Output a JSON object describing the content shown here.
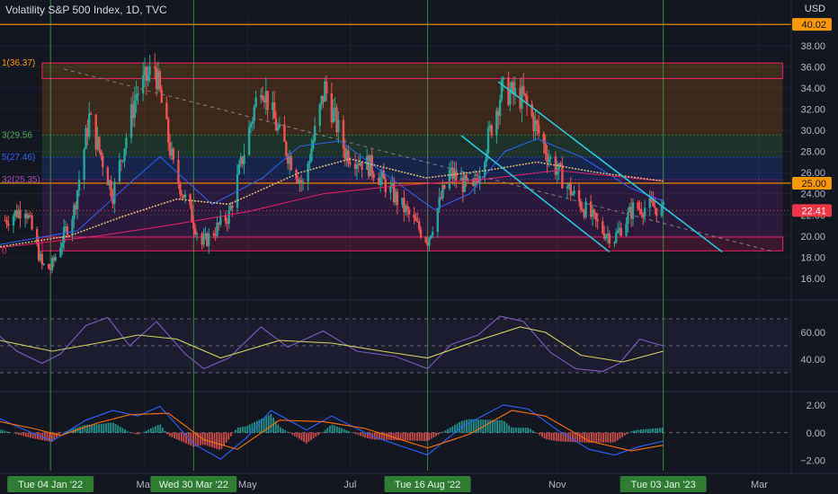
{
  "header": {
    "title": "Volatility S&P 500 Index, 1D, TVC",
    "currency": "USD"
  },
  "colors": {
    "background": "#131722",
    "up": "#26a69a",
    "down": "#ef5350",
    "ma_blue": "#2962ff",
    "ma_red": "#e91e63",
    "ma_dotted": "#d8b272",
    "channel": "#26c6da",
    "level_orange": "#ff9800",
    "rsi": "#7e57c2",
    "macd": "#2962ff",
    "signal": "#ff6d00",
    "vline": "#4caf50"
  },
  "chart_data": [
    {
      "type": "candlestick",
      "title": "Volatility S&P 500 Index, 1D, TVC",
      "y_axis": {
        "ticks": [
          "38.00",
          "36.00",
          "34.00",
          "32.00",
          "30.00",
          "28.00",
          "26.00",
          "24.00",
          "22.00",
          "20.00",
          "18.00",
          "16.00"
        ],
        "range": [
          14.8,
          40.8
        ]
      },
      "x_axis": {
        "date_range": [
          "2021-12-05",
          "2023-03-20"
        ],
        "labels": [
          {
            "date": "2022-03-01",
            "text": "Mar"
          },
          {
            "date": "2022-05-01",
            "text": "May"
          },
          {
            "date": "2022-07-01",
            "text": "Jul"
          },
          {
            "date": "2022-11-01",
            "text": "Nov"
          },
          {
            "date": "2023-03-01",
            "text": "Mar"
          }
        ],
        "highlighted_dates": [
          {
            "date": "2022-01-04",
            "text": "Tue 04 Jan '22"
          },
          {
            "date": "2022-03-30",
            "text": "Wed 30 Mar '22"
          },
          {
            "date": "2022-08-16",
            "text": "Tue 16 Aug '22"
          },
          {
            "date": "2023-01-03",
            "text": "Tue 03 Jan '23"
          }
        ]
      },
      "price_labels": [
        {
          "value": 40.02,
          "text": "40.02",
          "color": "#ff9800"
        },
        {
          "value": 25.0,
          "text": "25.00",
          "color": "#ff9800"
        },
        {
          "value": 22.41,
          "text": "22.41",
          "color": "#f23645"
        }
      ],
      "horizontal_levels": [
        40.02,
        25.0
      ],
      "fib_zones": [
        {
          "top": 36.37,
          "bottom": 34.9,
          "color": "#ff9800"
        },
        {
          "top": 34.9,
          "bottom": 29.56,
          "color": "#f57c00"
        },
        {
          "top": 29.56,
          "bottom": 27.46,
          "color": "#4caf50"
        },
        {
          "top": 27.46,
          "bottom": 25.35,
          "color": "#2962ff"
        },
        {
          "top": 25.35,
          "bottom": 19.9,
          "color": "#9c27b0"
        },
        {
          "top": 19.9,
          "bottom": 18.6,
          "color": "#e91e63"
        }
      ],
      "fib_labels": [
        {
          "value": 36.37,
          "text": "1(36.37)",
          "color": "#ff9800"
        },
        {
          "value": 29.56,
          "text": "3(29.56",
          "color": "#4caf50"
        },
        {
          "value": 27.46,
          "text": "5(27.46)",
          "color": "#2962ff"
        },
        {
          "value": 25.35,
          "text": "32(25.35)",
          "color": "#ab47bc"
        },
        {
          "value": 18.6,
          "text": "0",
          "color": "#e91e63"
        }
      ],
      "key_points": [
        {
          "date": "2021-12-08",
          "value": 21.5
        },
        {
          "date": "2021-12-20",
          "value": 22.8
        },
        {
          "date": "2021-12-30",
          "value": 17.2
        },
        {
          "date": "2022-01-04",
          "value": 16.9
        },
        {
          "date": "2022-01-18",
          "value": 22.5
        },
        {
          "date": "2022-01-27",
          "value": 31.2
        },
        {
          "date": "2022-02-10",
          "value": 24.0
        },
        {
          "date": "2022-02-24",
          "value": 33.5
        },
        {
          "date": "2022-03-07",
          "value": 36.0
        },
        {
          "date": "2022-03-18",
          "value": 26.5
        },
        {
          "date": "2022-04-04",
          "value": 19.2
        },
        {
          "date": "2022-04-20",
          "value": 22.0
        },
        {
          "date": "2022-05-09",
          "value": 34.7
        },
        {
          "date": "2022-05-20",
          "value": 29.5
        },
        {
          "date": "2022-06-03",
          "value": 24.8
        },
        {
          "date": "2022-06-16",
          "value": 34.0
        },
        {
          "date": "2022-06-28",
          "value": 28.0
        },
        {
          "date": "2022-07-14",
          "value": 26.5
        },
        {
          "date": "2022-08-01",
          "value": 22.8
        },
        {
          "date": "2022-08-16",
          "value": 19.6
        },
        {
          "date": "2022-08-29",
          "value": 26.0
        },
        {
          "date": "2022-09-12",
          "value": 24.2
        },
        {
          "date": "2022-09-29",
          "value": 33.8
        },
        {
          "date": "2022-10-12",
          "value": 33.0
        },
        {
          "date": "2022-10-27",
          "value": 27.5
        },
        {
          "date": "2022-11-10",
          "value": 24.0
        },
        {
          "date": "2022-11-28",
          "value": 20.5
        },
        {
          "date": "2022-12-05",
          "value": 19.8
        },
        {
          "date": "2022-12-16",
          "value": 22.6
        },
        {
          "date": "2022-12-28",
          "value": 22.8
        },
        {
          "date": "2023-01-03",
          "value": 22.4
        }
      ],
      "moving_averages": [
        {
          "color": "#2962ff",
          "points": [
            {
              "date": "2021-12-05",
              "value": 19.2
            },
            {
              "date": "2022-01-20",
              "value": 20.5
            },
            {
              "date": "2022-02-20",
              "value": 25.0
            },
            {
              "date": "2022-03-10",
              "value": 27.5
            },
            {
              "date": "2022-04-10",
              "value": 23.0
            },
            {
              "date": "2022-05-10",
              "value": 25.5
            },
            {
              "date": "2022-06-01",
              "value": 28.5
            },
            {
              "date": "2022-06-25",
              "value": 29.0
            },
            {
              "date": "2022-07-25",
              "value": 25.5
            },
            {
              "date": "2022-08-20",
              "value": 22.5
            },
            {
              "date": "2022-09-10",
              "value": 24.0
            },
            {
              "date": "2022-10-01",
              "value": 28.0
            },
            {
              "date": "2022-10-20",
              "value": 29.2
            },
            {
              "date": "2022-11-15",
              "value": 27.5
            },
            {
              "date": "2022-12-15",
              "value": 24.5
            },
            {
              "date": "2023-01-03",
              "value": 23.3
            }
          ]
        },
        {
          "color": "#e91e63",
          "points": [
            {
              "date": "2021-12-05",
              "value": 18.9
            },
            {
              "date": "2022-02-01",
              "value": 20.0
            },
            {
              "date": "2022-03-15",
              "value": 21.0
            },
            {
              "date": "2022-05-01",
              "value": 22.3
            },
            {
              "date": "2022-06-15",
              "value": 24.0
            },
            {
              "date": "2022-08-01",
              "value": 24.8
            },
            {
              "date": "2022-09-15",
              "value": 25.3
            },
            {
              "date": "2022-11-01",
              "value": 26.2
            },
            {
              "date": "2023-01-03",
              "value": 25.2
            }
          ]
        },
        {
          "color": "#d8b272",
          "dashed": true,
          "points": [
            {
              "date": "2021-12-05",
              "value": 19.0
            },
            {
              "date": "2022-01-15",
              "value": 20.0
            },
            {
              "date": "2022-02-15",
              "value": 21.8
            },
            {
              "date": "2022-03-20",
              "value": 23.5
            },
            {
              "date": "2022-04-20",
              "value": 23.0
            },
            {
              "date": "2022-06-01",
              "value": 26.0
            },
            {
              "date": "2022-07-01",
              "value": 27.3
            },
            {
              "date": "2022-08-15",
              "value": 25.5
            },
            {
              "date": "2022-09-20",
              "value": 26.2
            },
            {
              "date": "2022-10-20",
              "value": 27.0
            },
            {
              "date": "2022-11-25",
              "value": 26.0
            },
            {
              "date": "2023-01-03",
              "value": 25.2
            }
          ]
        }
      ],
      "trend_lines": [
        {
          "color": "#26c6da",
          "from": {
            "date": "2022-09-27",
            "value": 34.6
          },
          "to": {
            "date": "2023-02-07",
            "value": 18.5
          }
        },
        {
          "color": "#26c6da",
          "from": {
            "date": "2022-09-05",
            "value": 29.5
          },
          "to": {
            "date": "2022-12-02",
            "value": 18.5
          }
        },
        {
          "color": "#7a7f8c",
          "dashed": true,
          "from": {
            "date": "2022-01-12",
            "value": 35.8
          },
          "to": {
            "date": "2023-03-10",
            "value": 18.5
          }
        }
      ]
    },
    {
      "type": "line",
      "name": "RSI",
      "y_axis": {
        "ticks": [
          "60.00",
          "40.00"
        ],
        "range": [
          20,
          80
        ]
      },
      "bands": [
        70,
        50,
        30
      ],
      "series": [
        {
          "color": "#7e57c2",
          "points": [
            {
              "date": "2021-12-05",
              "value": 57
            },
            {
              "date": "2021-12-15",
              "value": 46
            },
            {
              "date": "2021-12-30",
              "value": 37
            },
            {
              "date": "2022-01-10",
              "value": 44
            },
            {
              "date": "2022-01-25",
              "value": 65
            },
            {
              "date": "2022-02-07",
              "value": 71
            },
            {
              "date": "2022-02-20",
              "value": 50
            },
            {
              "date": "2022-03-08",
              "value": 68
            },
            {
              "date": "2022-03-25",
              "value": 44
            },
            {
              "date": "2022-04-05",
              "value": 33
            },
            {
              "date": "2022-04-20",
              "value": 41
            },
            {
              "date": "2022-05-09",
              "value": 64
            },
            {
              "date": "2022-05-25",
              "value": 49
            },
            {
              "date": "2022-06-15",
              "value": 61
            },
            {
              "date": "2022-07-05",
              "value": 46
            },
            {
              "date": "2022-07-28",
              "value": 42
            },
            {
              "date": "2022-08-16",
              "value": 33
            },
            {
              "date": "2022-08-30",
              "value": 51
            },
            {
              "date": "2022-09-15",
              "value": 58
            },
            {
              "date": "2022-09-28",
              "value": 72
            },
            {
              "date": "2022-10-12",
              "value": 68
            },
            {
              "date": "2022-10-28",
              "value": 45
            },
            {
              "date": "2022-11-12",
              "value": 33
            },
            {
              "date": "2022-11-28",
              "value": 31
            },
            {
              "date": "2022-12-08",
              "value": 37
            },
            {
              "date": "2022-12-20",
              "value": 55
            },
            {
              "date": "2022-12-28",
              "value": 52
            },
            {
              "date": "2023-01-03",
              "value": 50
            }
          ]
        },
        {
          "color": "#d8cf5c",
          "points": [
            {
              "date": "2021-12-05",
              "value": 54
            },
            {
              "date": "2022-01-05",
              "value": 46
            },
            {
              "date": "2022-02-01",
              "value": 52
            },
            {
              "date": "2022-02-25",
              "value": 58
            },
            {
              "date": "2022-03-20",
              "value": 55
            },
            {
              "date": "2022-04-15",
              "value": 41
            },
            {
              "date": "2022-05-20",
              "value": 54
            },
            {
              "date": "2022-06-20",
              "value": 52
            },
            {
              "date": "2022-07-20",
              "value": 46
            },
            {
              "date": "2022-08-16",
              "value": 41
            },
            {
              "date": "2022-09-15",
              "value": 54
            },
            {
              "date": "2022-10-10",
              "value": 64
            },
            {
              "date": "2022-10-25",
              "value": 60
            },
            {
              "date": "2022-11-15",
              "value": 43
            },
            {
              "date": "2022-12-10",
              "value": 38
            },
            {
              "date": "2023-01-03",
              "value": 46
            }
          ]
        }
      ]
    },
    {
      "type": "bar",
      "name": "MACD",
      "y_axis": {
        "ticks": [
          "2.00",
          "0.00",
          "-2.00"
        ],
        "range": [
          -2.6,
          2.7
        ]
      },
      "lines": [
        {
          "color": "#2962ff",
          "points": [
            {
              "date": "2021-12-05",
              "value": 1.0
            },
            {
              "date": "2021-12-20",
              "value": 0.2
            },
            {
              "date": "2022-01-05",
              "value": -0.6
            },
            {
              "date": "2022-01-25",
              "value": 0.9
            },
            {
              "date": "2022-02-10",
              "value": 1.6
            },
            {
              "date": "2022-02-25",
              "value": 1.2
            },
            {
              "date": "2022-03-10",
              "value": 1.9
            },
            {
              "date": "2022-03-30",
              "value": -0.8
            },
            {
              "date": "2022-04-15",
              "value": -1.9
            },
            {
              "date": "2022-04-30",
              "value": -0.4
            },
            {
              "date": "2022-05-15",
              "value": 1.6
            },
            {
              "date": "2022-06-05",
              "value": 0.2
            },
            {
              "date": "2022-06-20",
              "value": 1.2
            },
            {
              "date": "2022-07-15",
              "value": -0.3
            },
            {
              "date": "2022-08-16",
              "value": -1.6
            },
            {
              "date": "2022-09-05",
              "value": 0.4
            },
            {
              "date": "2022-09-30",
              "value": 2.0
            },
            {
              "date": "2022-10-15",
              "value": 1.7
            },
            {
              "date": "2022-11-01",
              "value": 0.2
            },
            {
              "date": "2022-11-20",
              "value": -1.2
            },
            {
              "date": "2022-12-05",
              "value": -1.6
            },
            {
              "date": "2022-12-20",
              "value": -1.0
            },
            {
              "date": "2023-01-03",
              "value": -0.6
            }
          ]
        },
        {
          "color": "#ff6d00",
          "points": [
            {
              "date": "2021-12-05",
              "value": 0.8
            },
            {
              "date": "2021-12-25",
              "value": 0.3
            },
            {
              "date": "2022-01-10",
              "value": -0.2
            },
            {
              "date": "2022-02-01",
              "value": 0.7
            },
            {
              "date": "2022-02-20",
              "value": 1.3
            },
            {
              "date": "2022-03-15",
              "value": 1.4
            },
            {
              "date": "2022-04-05",
              "value": -0.5
            },
            {
              "date": "2022-04-25",
              "value": -1.2
            },
            {
              "date": "2022-05-20",
              "value": 0.9
            },
            {
              "date": "2022-06-15",
              "value": 0.8
            },
            {
              "date": "2022-07-10",
              "value": 0.3
            },
            {
              "date": "2022-08-16",
              "value": -1.1
            },
            {
              "date": "2022-09-10",
              "value": -0.1
            },
            {
              "date": "2022-10-05",
              "value": 1.6
            },
            {
              "date": "2022-10-25",
              "value": 1.2
            },
            {
              "date": "2022-11-20",
              "value": -0.6
            },
            {
              "date": "2022-12-15",
              "value": -1.3
            },
            {
              "date": "2023-01-03",
              "value": -0.9
            }
          ]
        }
      ]
    }
  ]
}
